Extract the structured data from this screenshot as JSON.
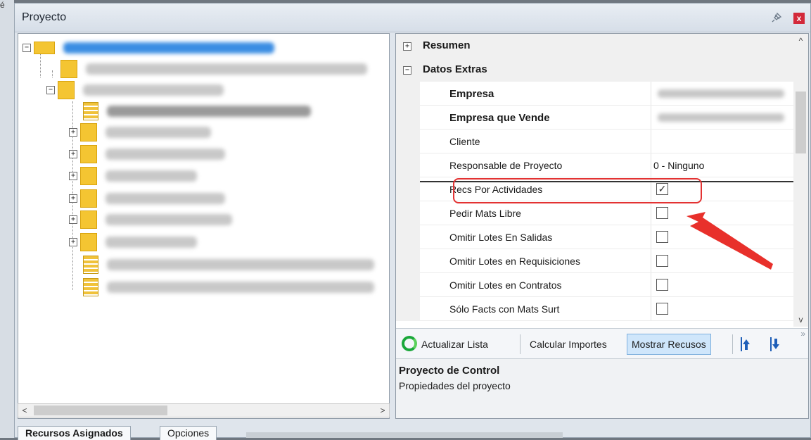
{
  "window": {
    "title": "Proyecto",
    "pin_icon": "pin-icon",
    "close_label": "x",
    "left_edge_text": "é"
  },
  "tree": {
    "expander_minus": "−",
    "expander_plus": "+",
    "scroll_left": "<",
    "scroll_right": ">"
  },
  "properties": {
    "categories": [
      {
        "label": "Resumen",
        "expander": "+"
      },
      {
        "label": "Datos Extras",
        "expander": "−"
      }
    ],
    "rows": [
      {
        "name": "Empresa",
        "bold": true
      },
      {
        "name": "Empresa que Vende",
        "bold": true
      },
      {
        "name": "Cliente"
      },
      {
        "name": "Responsable de Proyecto",
        "value": "0 - Ninguno"
      },
      {
        "name": "Recs Por Actividades",
        "checked": true
      },
      {
        "name": "Pedir Mats Libre",
        "checked": false
      },
      {
        "name": "Omitir Lotes En Salidas",
        "checked": false
      },
      {
        "name": "Omitir Lotes en Requisiciones",
        "checked": false
      },
      {
        "name": "Omitir Lotes en Contratos",
        "checked": false
      },
      {
        "name": "Sólo Facts con Mats Surt",
        "checked": false
      }
    ],
    "check_mark": "✓",
    "scroll_up": "^",
    "scroll_down": "v"
  },
  "toolbar": {
    "refresh_label": "Actualizar Lista",
    "calc_label": "Calcular Importes",
    "show_label": "Mostrar Recusos",
    "up_icon": "arrow-up-icon",
    "down_icon": "arrow-down-icon",
    "more": "»"
  },
  "description": {
    "title": "Proyecto de Control",
    "text": "Propiedades del proyecto"
  },
  "tabs": [
    {
      "label": "Recursos Asignados"
    },
    {
      "label": "Opciones"
    }
  ],
  "colors": {
    "highlight": "#e33232",
    "accent": "#1f5fb8",
    "refresh": "#1aa73a"
  }
}
